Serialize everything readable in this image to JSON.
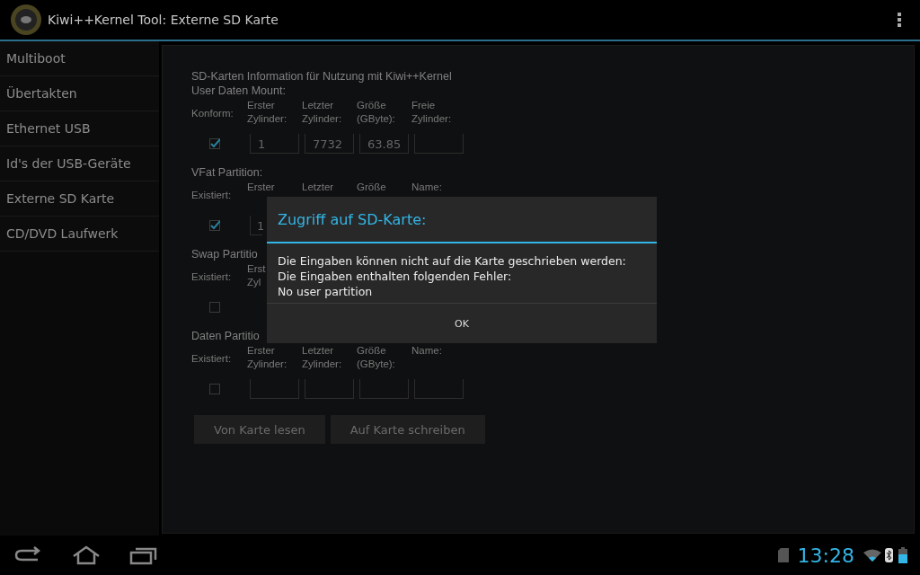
{
  "app_bar": {
    "title": "Kiwi++Kernel Tool: Externe SD Karte"
  },
  "sidebar": {
    "items": [
      {
        "label": "Multiboot"
      },
      {
        "label": "Übertakten"
      },
      {
        "label": "Ethernet USB"
      },
      {
        "label": "Id's der USB-Geräte"
      },
      {
        "label": "Externe SD Karte"
      },
      {
        "label": "CD/DVD Laufwerk"
      }
    ]
  },
  "sections": [
    {
      "title_lines": [
        "SD-Karten Information für Nutzung mit Kiwi++Kernel",
        "User Daten Mount:"
      ],
      "state_label": "Konform:",
      "columns": [
        [
          "Erster",
          "Zylinder:"
        ],
        [
          "Letzter",
          "Zylinder:"
        ],
        [
          "Größe",
          "(GByte):"
        ],
        [
          "Freie",
          "Zylinder:"
        ]
      ],
      "checked": true,
      "fields": [
        {
          "kind": "filled",
          "value": "1"
        },
        {
          "kind": "filled",
          "value": "7732"
        },
        {
          "kind": "filled",
          "value": "63.85"
        },
        {
          "kind": "blank"
        }
      ]
    },
    {
      "title_lines": [
        "VFat Partition:"
      ],
      "state_label": "Existiert:",
      "columns": [
        [
          "Erster"
        ],
        [
          "Letzter"
        ],
        [
          "Größe"
        ],
        [
          "Name:"
        ]
      ],
      "checked": true,
      "fields": [
        {
          "kind": "filled",
          "value": "1"
        }
      ]
    },
    {
      "title_lines": [
        "Swap Partitio"
      ],
      "state_label": "Existiert:",
      "columns": [
        [
          "Erst",
          "Zyl"
        ]
      ],
      "checked": false
    },
    {
      "title_lines": [
        "Daten Partitio"
      ],
      "state_label": "Existiert:",
      "columns": [
        [
          "Erster",
          "Zylinder:"
        ],
        [
          "Letzter",
          "Zylinder:"
        ],
        [
          "Größe",
          "(GByte):"
        ],
        [
          "Name:"
        ]
      ],
      "checked": false,
      "fields": [
        {
          "kind": "blank"
        },
        {
          "kind": "blank"
        },
        {
          "kind": "blank"
        },
        {
          "kind": "blank"
        }
      ]
    }
  ],
  "buttons": [
    "Von Karte lesen",
    "Auf Karte schreiben"
  ],
  "dialog": {
    "title": "Zugriff auf SD-Karte:",
    "message_lines": [
      "Die Eingaben können nicht auf die Karte geschrieben werden:",
      "Die Eingaben enthalten folgenden Fehler:",
      "No user partition"
    ],
    "button": "OK"
  },
  "status_bar": {
    "time": "13:28"
  }
}
